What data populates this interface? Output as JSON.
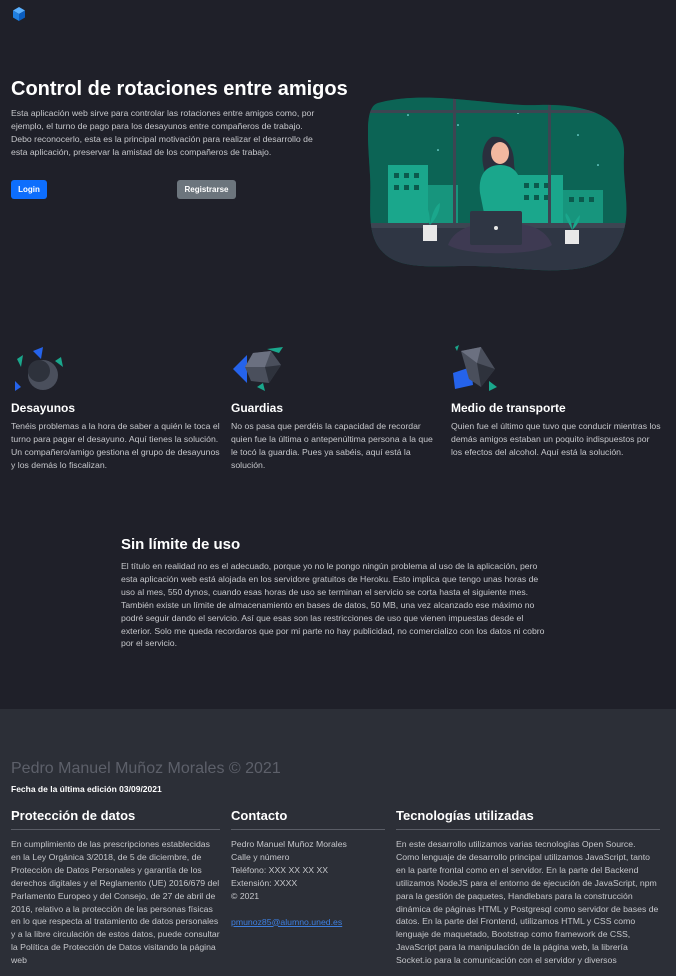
{
  "hero": {
    "title": "Control de rotaciones entre amigos",
    "text": "Esta aplicación web sirve para controlar las rotaciones entre amigos como, por ejemplo, el turno de pago para los desayunos entre compañeros de trabajo. Debo reconocerlo, esta es la principal motivación para realizar el desarrollo de esta aplicación, preservar la amistad de los compañeros de trabajo.",
    "login_label": "Login",
    "register_label": "Registrarse"
  },
  "features": [
    {
      "title": "Desayunos",
      "text": "Tenéis problemas a la hora de saber a quién le toca el turno para pagar el desayuno. Aquí tienes la solución. Un compañero/amigo gestiona el grupo de desayunos y los demás lo fiscalizan."
    },
    {
      "title": "Guardias",
      "text": "No os pasa que perdéis la capacidad de recordar quien fue la última o antepenúltima persona a la que le tocó la guardia. Pues ya sabéis, aquí está la solución."
    },
    {
      "title": "Medio de transporte",
      "text": "Quien fue el último que tuvo que conducir mientras los demás amigos estaban un poquito indispuestos por los efectos del alcohol. Aquí está la solución."
    }
  ],
  "limit": {
    "title": "Sin límite de uso",
    "text": "El título en realidad no es el adecuado, porque yo no le pongo ningún problema al uso de la aplicación, pero esta aplicación web está alojada en los servidore gratuitos de Heroku. Esto implica que tengo unas horas de uso al mes, 550 dynos, cuando esas horas de uso se terminan el servicio se corta hasta el siguiente mes. También existe un límite de almacenamiento en bases de datos, 50 MB, una vez alcanzado ese máximo no podré seguir dando el servicio. Así que esas son las restricciones de uso que vienen impuestas desde el exterior. Solo me queda recordaros que por mi parte no hay publicidad, no comercializo con los datos ni cobro por el servicio."
  },
  "footer": {
    "name": "Pedro Manuel Muñoz Morales © 2021",
    "date": "Fecha de la última edición 03/09/2021",
    "privacy_title": "Protección de datos",
    "privacy_text": "En cumplimiento de las prescripciones establecidas en la Ley Orgánica 3/2018, de 5 de diciembre, de Protección de Datos Personales y garantía de los derechos digitales y el Reglamento (UE) 2016/679 del Parlamento Europeo y del Consejo, de 27 de abril de 2016, relativo a la protección de las personas físicas en lo que respecta al tratamiento de datos personales y a la libre circulación de estos datos, puede consultar la Política de Protección de Datos visitando la página web",
    "contact_title": "Contacto",
    "contact_lines": [
      "Pedro Manuel Muñoz Morales",
      "Calle y número",
      "Teléfono: XXX XX XX XX",
      "Extensión: XXXX",
      "© 2021"
    ],
    "contact_email": "pmunoz85@alumno.uned.es",
    "tech_title": "Tecnologías utilizadas",
    "tech_text": "En este desarrollo utilizamos varias tecnologías Open Source. Como lenguaje de desarrollo principal utilizamos JavaScript, tanto en la parte frontal como en el servidor. En la parte del Backend utilizamos NodeJS para el entorno de ejecución de JavaScript, npm para la gestión de paquetes, Handlebars para la construcción dinámica de páginas HTML y Postgresql como servidor de bases de datos. En la parte del Frontend, utilizamos HTML y CSS como lenguaje de maquetado, Bootstrap como framework de CSS, JavaScript para la manipulación de la página web, la librería Socket.io para la comunicación con el servidor y diversos"
  },
  "colors": {
    "primary": "#0d6efd",
    "secondary": "#6c757d",
    "background": "#1f2029",
    "footer": "#2c2f37",
    "accent": "#1aa78c"
  }
}
